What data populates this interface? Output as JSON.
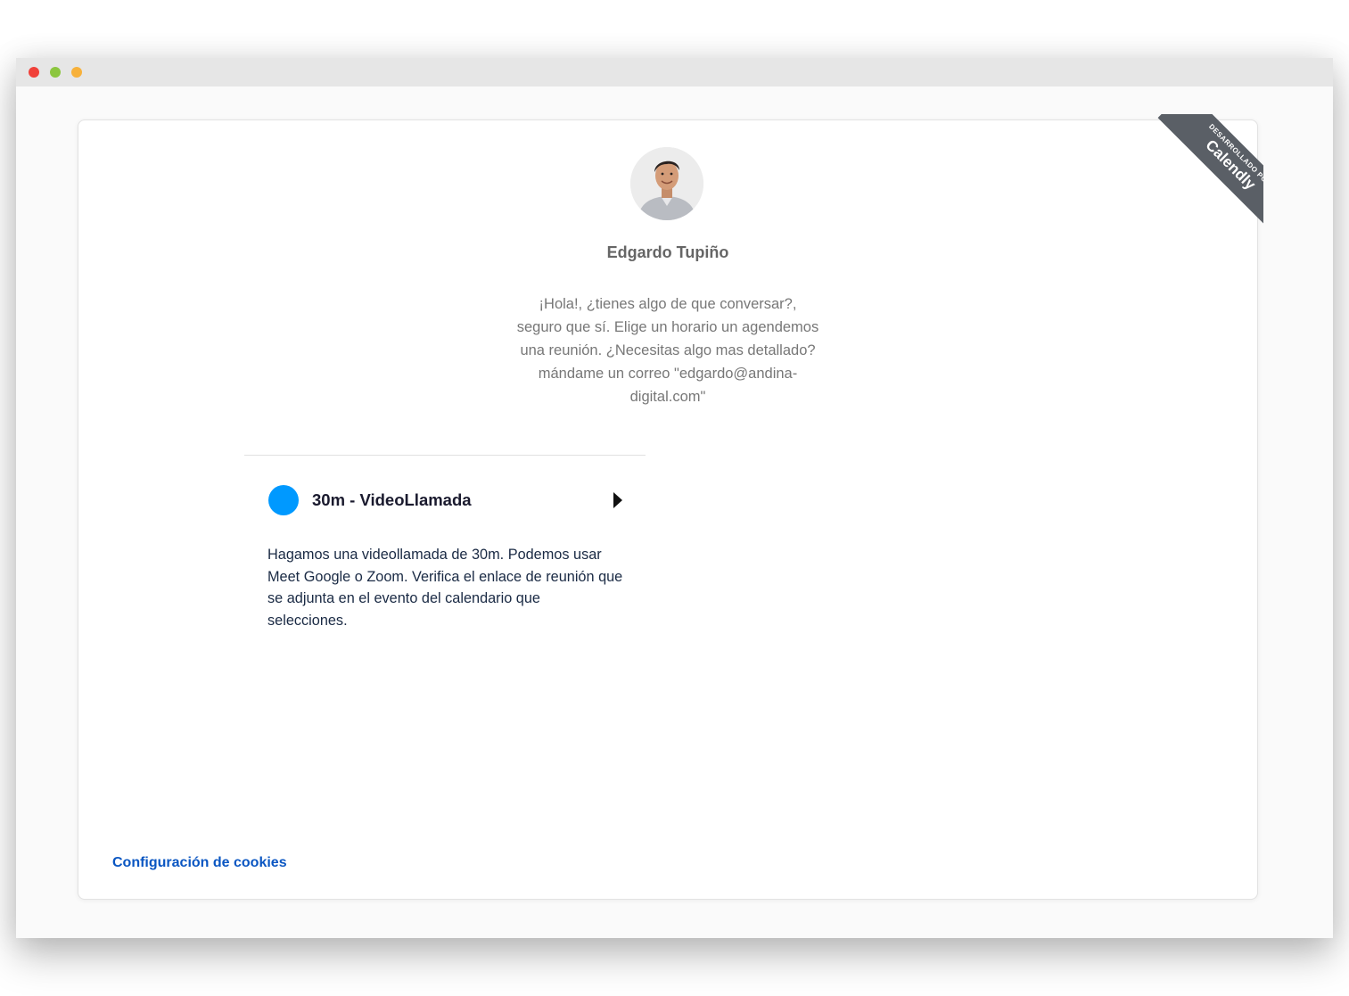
{
  "window": {
    "controls": [
      {
        "name": "close",
        "color": "#f0413a"
      },
      {
        "name": "minimize",
        "color": "#8cc63f"
      },
      {
        "name": "maximize",
        "color": "#f7b13b"
      }
    ]
  },
  "ribbon": {
    "small_text": "DESARROLLADO POR",
    "brand": "Calendly"
  },
  "profile": {
    "avatar_icon": "person-avatar-icon",
    "name": "Edgardo Tupiño",
    "description": "¡Hola!, ¿tienes algo de que conversar?, seguro que sí. Elige un horario un agendemos una reunión. ¿Necesitas algo mas detallado? mándame un correo \"edgardo@andina-digital.com\""
  },
  "event": {
    "color": "#0099ff",
    "title": "30m - VideoLlamada",
    "arrow_icon": "triangle-right-icon",
    "description": "Hagamos una videollamada de 30m. Podemos usar Meet Google o Zoom. Verifica el enlace de reunión que se adjunta en el evento del calendario que selecciones."
  },
  "footer": {
    "cookie_link": "Configuración de cookies"
  }
}
